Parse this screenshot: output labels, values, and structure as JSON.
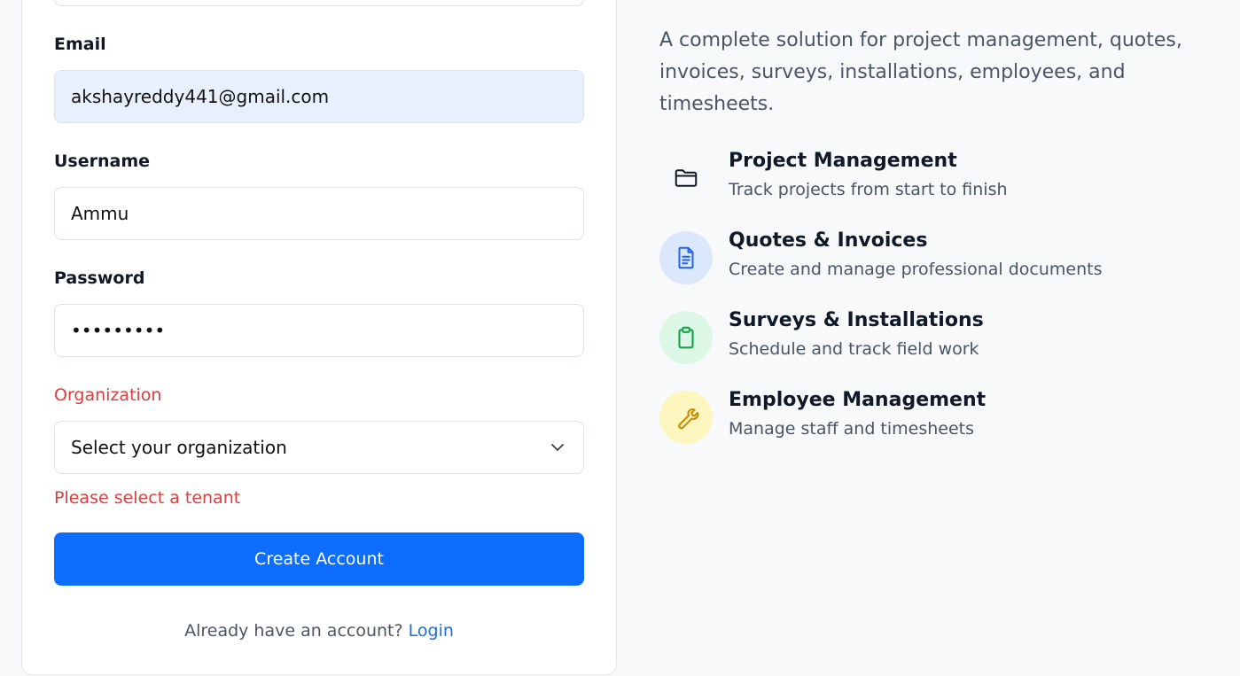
{
  "signup_form": {
    "email": {
      "label": "Email",
      "value": "akshayreddy441@gmail.com"
    },
    "username": {
      "label": "Username",
      "value": "Ammu"
    },
    "password": {
      "label": "Password",
      "value": "•••••••••"
    },
    "organization": {
      "label": "Organization",
      "selected": "Select your organization",
      "error": "Please select a tenant"
    },
    "submit_label": "Create Account",
    "footer_prompt": "Already have an account?",
    "login_link": "Login"
  },
  "info_panel": {
    "intro": "A complete solution for project management, quotes, invoices, surveys, installations, employees, and timesheets.",
    "features": [
      {
        "icon": "folder-icon",
        "title": "Project Management",
        "description": "Track projects from start to finish",
        "bg": "#f8f9fb",
        "color": "#111827"
      },
      {
        "icon": "document-icon",
        "title": "Quotes & Invoices",
        "description": "Create and manage professional documents",
        "bg": "#dbe7fb",
        "color": "#2563eb"
      },
      {
        "icon": "clipboard-icon",
        "title": "Surveys & Installations",
        "description": "Schedule and track field work",
        "bg": "#dcf7e6",
        "color": "#16a34a"
      },
      {
        "icon": "wrench-icon",
        "title": "Employee Management",
        "description": "Manage staff and timesheets",
        "bg": "#fdf6bf",
        "color": "#ca8a04"
      }
    ]
  },
  "colors": {
    "primary": "#0d6efd",
    "error": "#dc3d3d",
    "autofill": "#e8f0fe",
    "link": "#1d6fd8"
  }
}
